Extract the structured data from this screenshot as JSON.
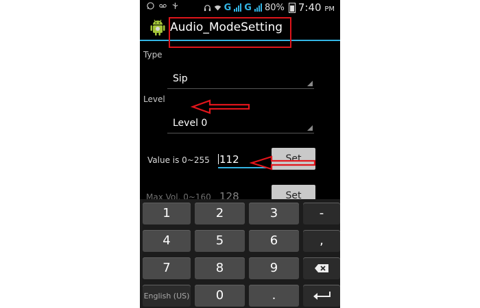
{
  "status_bar": {
    "network_1": "G",
    "network_2": "G",
    "battery": "80%",
    "time": "7:40",
    "ampm": "PM"
  },
  "action_bar": {
    "title": "Audio_ModeSetting"
  },
  "form": {
    "type_label": "Type",
    "type_value": "Sip",
    "level_label": "Level",
    "level_value": "Level 0",
    "value_label": "Value is 0~255",
    "value_input": "112",
    "set_label": "Set",
    "maxvol_label": "Max Vol. 0~160",
    "maxvol_input": "128",
    "set2_label": "Set"
  },
  "keyboard": {
    "row1": [
      "1",
      "2",
      "3",
      "-"
    ],
    "row2": [
      "4",
      "5",
      "6",
      ","
    ],
    "row3": [
      "7",
      "8",
      "9"
    ],
    "row4_lang": "English (US)",
    "row4_zero": "0",
    "row4_dot": "."
  },
  "annotation_color": "#e0151b",
  "accent_color": "#33b5e5"
}
